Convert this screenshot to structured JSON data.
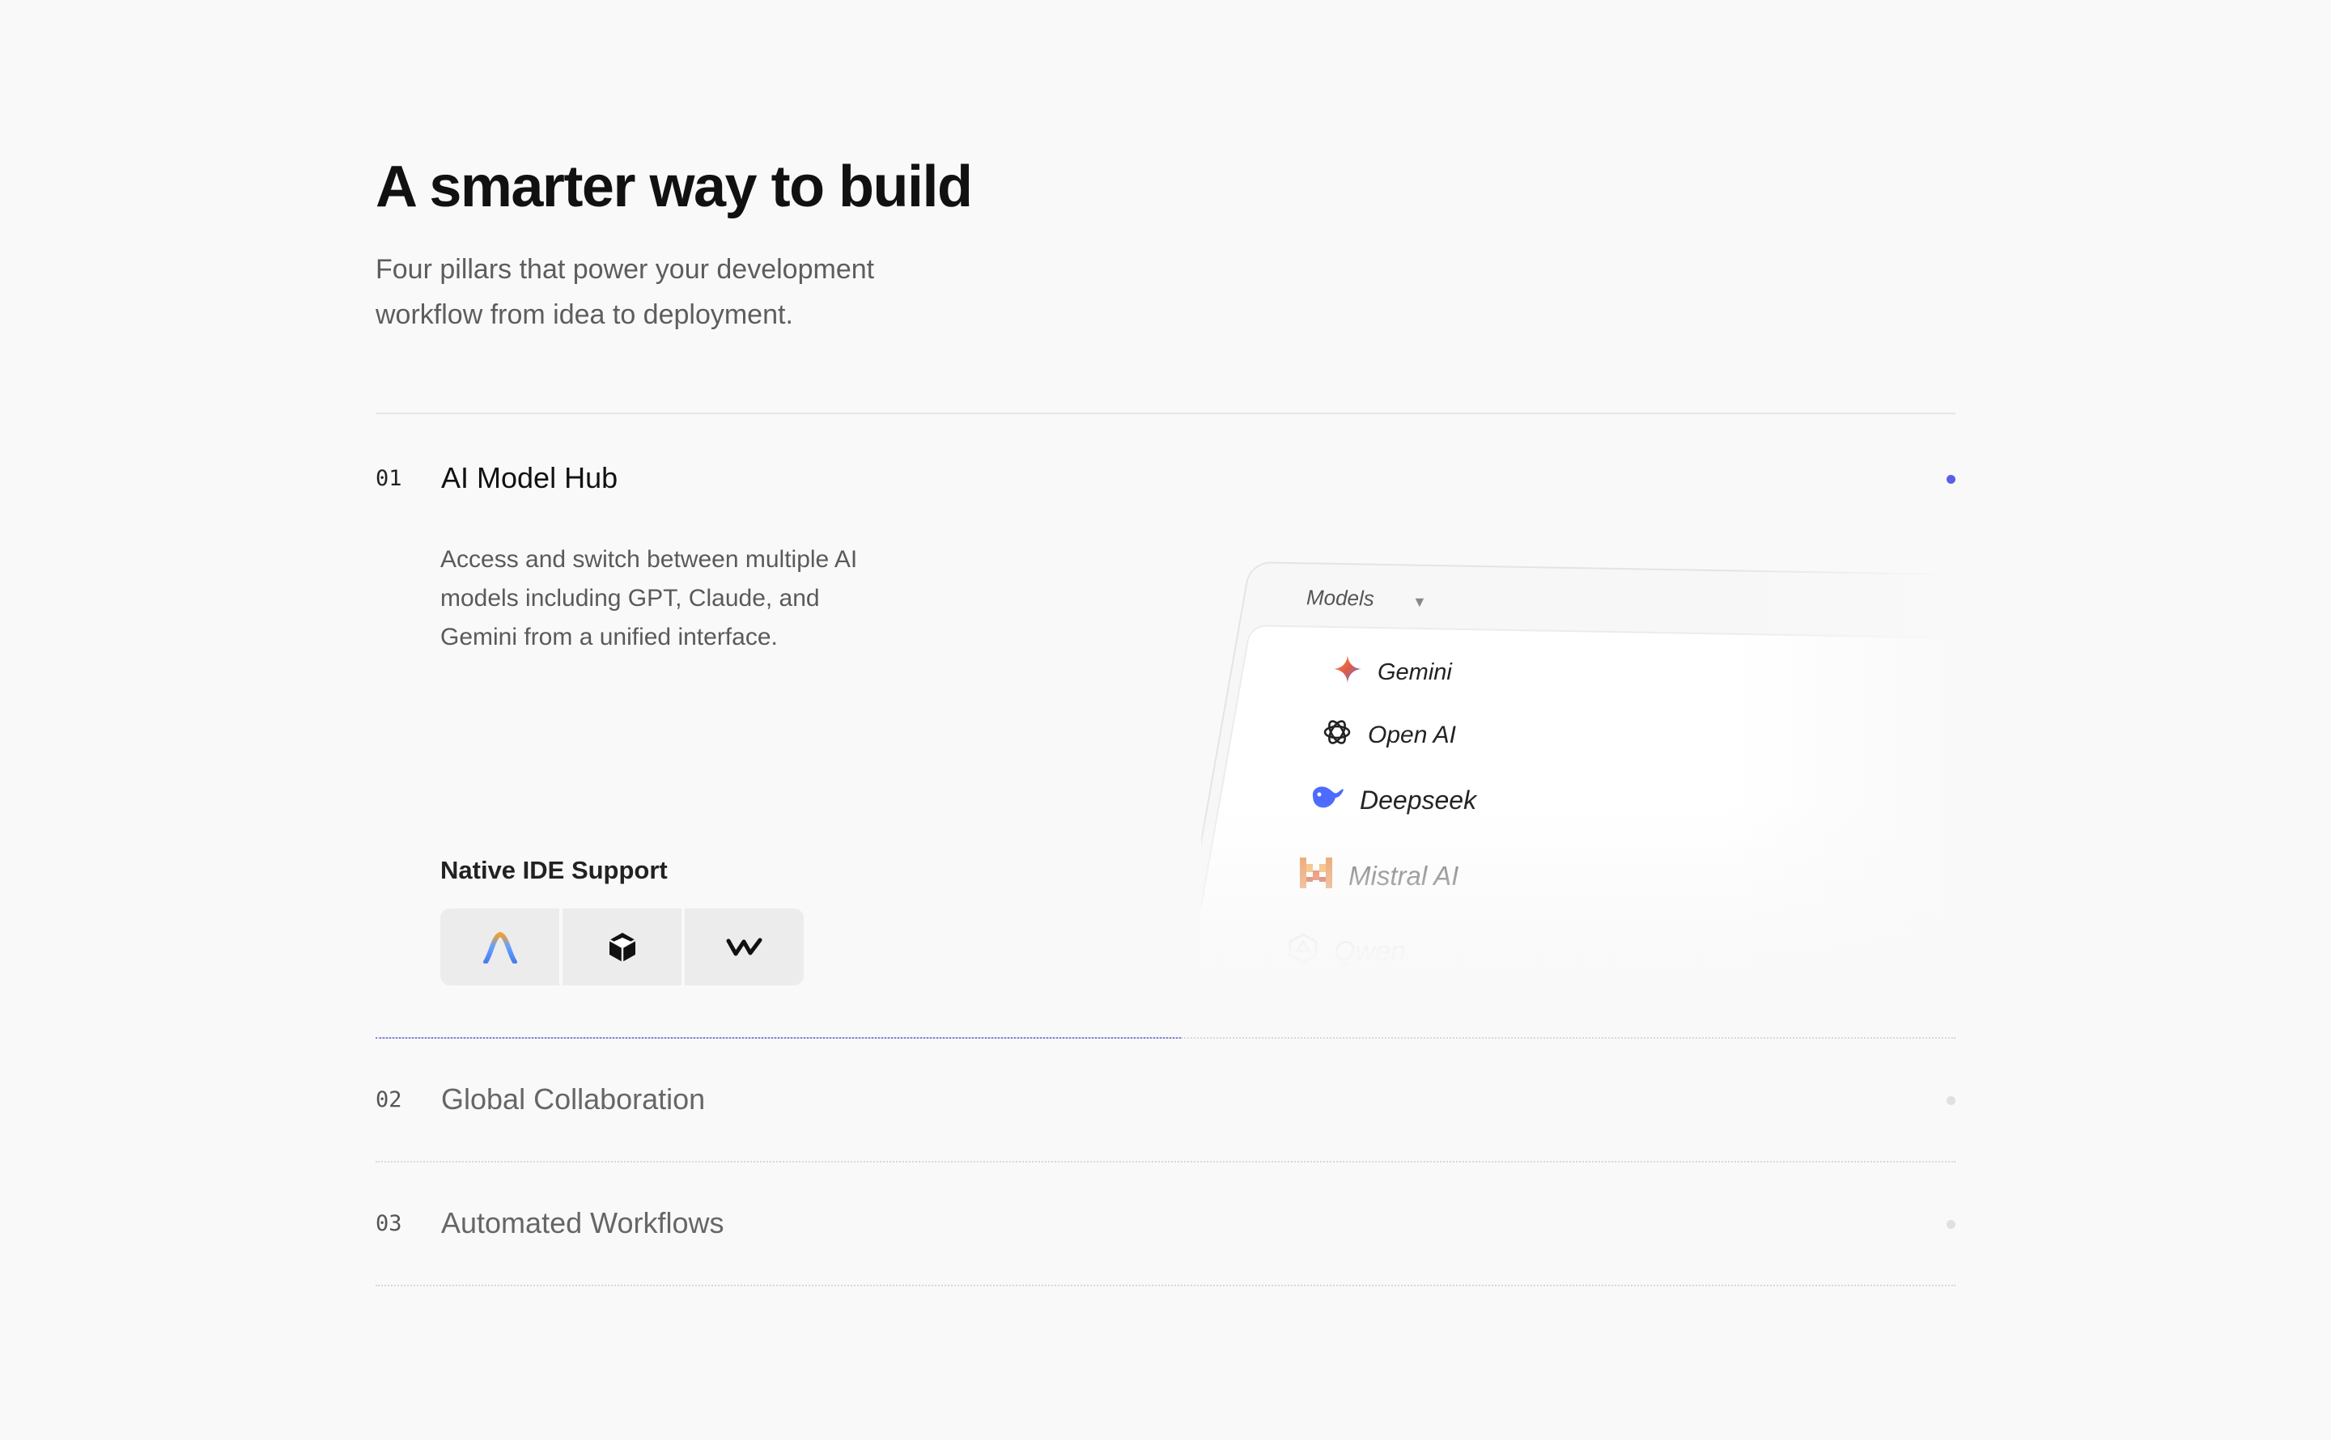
{
  "hero": {
    "title": "A smarter way to build",
    "subtitle": "Four pillars that power your development workflow from idea to deployment."
  },
  "pillars": [
    {
      "number": "01",
      "title": "AI Model Hub",
      "active": true,
      "description": "Access and switch between multiple AI models including GPT, Claude, and Gemini from a unified interface.",
      "ide_support": {
        "label": "Native IDE Support",
        "icons": [
          "antigravity-icon",
          "cursor-icon",
          "windsurf-icon"
        ]
      }
    },
    {
      "number": "02",
      "title": "Global Collaboration",
      "active": false
    },
    {
      "number": "03",
      "title": "Automated Workflows",
      "active": false
    }
  ],
  "models_panel": {
    "header": "Models",
    "caret_icon": "caret-down-icon",
    "items": [
      {
        "label": "Gemini",
        "icon": "gemini-icon"
      },
      {
        "label": "Open AI",
        "icon": "openai-icon"
      },
      {
        "label": "Deepseek",
        "icon": "deepseek-icon"
      },
      {
        "label": "Mistral AI",
        "icon": "mistral-icon"
      },
      {
        "label": "Qwen",
        "icon": "qwen-icon"
      }
    ]
  },
  "colors": {
    "background": "#f9f9f9",
    "accent": "#5b5ee6",
    "title": "#111111",
    "muted_text": "#5a5a5a"
  }
}
